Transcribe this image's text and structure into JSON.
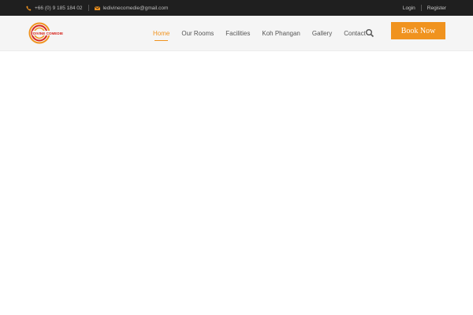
{
  "topbar": {
    "phone": "+66 (0) 9 185 184 02",
    "email": "ledivinecomedie@gmail.com",
    "login_label": "Login",
    "register_label": "Register",
    "icons": {
      "phone": "phone-icon",
      "email": "envelope-icon"
    }
  },
  "header": {
    "logo_text": "DIVINE COMEDIE",
    "nav": [
      {
        "label": "Home",
        "active": true
      },
      {
        "label": "Our Rooms"
      },
      {
        "label": "Facilities"
      },
      {
        "label": "Koh Phangan"
      },
      {
        "label": "Gallery"
      },
      {
        "label": "Contact"
      }
    ],
    "search_icon": "search-icon",
    "book_label": "Book Now"
  },
  "colors": {
    "accent": "#f0931f",
    "topbar_bg": "#1f1f1f",
    "header_bg": "#f5f5f5",
    "logo_red": "#d7261e"
  }
}
